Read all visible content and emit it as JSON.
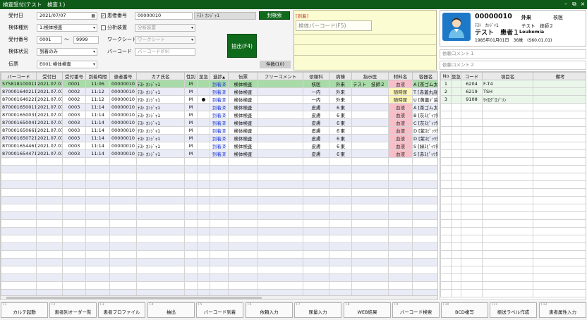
{
  "window": {
    "title": "検査受付(テスト　検査１)"
  },
  "form": {
    "receipt_date_label": "受付日",
    "receipt_date": "2021/07/07",
    "patient_no_label": "患者番号",
    "patient_no": "00000010",
    "patient_kana": "ﾃｽﾄ ｶﾝｼﾞｬ1",
    "seal_search_label": "封検索",
    "specimen_type_label": "検体種別",
    "specimen_type": "1:検体検査",
    "analyzer_label": "分析装置",
    "analyzer_placeholder": "分析装置",
    "receipt_no_label": "受付番号",
    "receipt_no_from": "0001",
    "tilde": "〜",
    "receipt_no_to": "9999",
    "worksheet_label": "ワークシート",
    "worksheet_placeholder": "ワークシート",
    "status_label": "検体状況",
    "status": "到着のみ",
    "barcode_label": "バーコード",
    "barcode_placeholder": "バーコード(F9)",
    "slip_label": "伝票",
    "slip": "E001:検体検査",
    "extract_label": "抽出(F4)",
    "count_label": "件数(10)"
  },
  "notice": {
    "header": "[到着]",
    "barcode_placeholder": "検体バーコード(F5)"
  },
  "patient": {
    "id": "00000010",
    "kana": "ﾃｽﾄ　ｶﾝｼﾞｬ1",
    "name": "テスト　患者１",
    "dept": "外来",
    "ward": "核医",
    "doctor": "テスト　技師２",
    "disease": "Leukemia",
    "birth": "1985年01月01日　36歳　(S60.01.01)"
  },
  "comments": {
    "c1": "依頼コメント１",
    "c2": "依頼コメント２"
  },
  "main_table": {
    "headers": [
      "バーコード",
      "受付日",
      "受付番号",
      "到着時間",
      "患者番号",
      "カナ氏名",
      "性別",
      "至急",
      "進捗",
      "伝票",
      "フリーコメント",
      "依頼科",
      "病棟",
      "指示医",
      "材料名",
      "容器名"
    ],
    "sort_mark": "▲",
    "rows": [
      [
        "575818100011",
        "2021.07.07",
        "0001",
        "11:06",
        "00000010",
        "ﾃｽﾄ ｶﾝｼﾞｬ1",
        "M",
        "",
        "到着済",
        "検体検査",
        "",
        "核医",
        "外来",
        "テスト　技師２",
        "血液",
        "A [茶ゴム太長]"
      ],
      [
        "870001640211",
        "2021.07.07",
        "0002",
        "11:12",
        "00000010",
        "ﾃｽﾄ ｶﾝｼﾞｬ1",
        "M",
        "",
        "到着済",
        "検体検査",
        "",
        "一内",
        "外来",
        "",
        "随時尿",
        "T [赤蓋丸底]"
      ],
      [
        "870001640221",
        "2021.07.07",
        "0002",
        "11:12",
        "00000010",
        "ﾃｽﾄ ｶﾝｼﾞｬ1",
        "M",
        "●",
        "到着済",
        "検体検査",
        "",
        "一内",
        "外来",
        "",
        "随時尿",
        "U [黄蓋ﾏﾞ底]"
      ],
      [
        "870001650011",
        "2021.07.07",
        "0003",
        "11:14",
        "00000010",
        "ﾃｽﾄ ｶﾝｼﾞｬ1",
        "M",
        "",
        "到着済",
        "検体検査",
        "",
        "皮膚",
        "６東",
        "",
        "血液",
        "A [茶ゴム太長]"
      ],
      [
        "870001650031",
        "2021.07.07",
        "0003",
        "11:14",
        "00000010",
        "ﾃｽﾄ ｶﾝｼﾞｬ1",
        "M",
        "",
        "到着済",
        "検体検査",
        "",
        "皮膚",
        "６東",
        "",
        "血液",
        "B [灰ｽﾋﾟｯﾂ短]"
      ],
      [
        "870001650041",
        "2021.07.07",
        "0003",
        "11:14",
        "00000010",
        "ﾃｽﾄ ｶﾝｼﾞｬ1",
        "M",
        "",
        "到着済",
        "検体検査",
        "",
        "皮膚",
        "６東",
        "",
        "血液",
        "C [灰ｽﾋﾟｯﾂ短]"
      ],
      [
        "870001650661",
        "2021.07.07",
        "0003",
        "11:14",
        "00000010",
        "ﾃｽﾄ ｶﾝｼﾞｬ1",
        "M",
        "",
        "到着済",
        "検体検査",
        "",
        "皮膚",
        "６東",
        "",
        "血液",
        "D [紫ｽﾋﾟｯﾂ短]"
      ],
      [
        "870001650721",
        "2021.07.07",
        "0003",
        "11:14",
        "00000010",
        "ﾃｽﾄ ｶﾝｼﾞｬ1",
        "M",
        "",
        "到着済",
        "検体検査",
        "",
        "皮膚",
        "６東",
        "",
        "血液",
        "D [紫ｽﾋﾟｯﾂ短]"
      ],
      [
        "870001654461",
        "2021.07.07",
        "0003",
        "11:14",
        "00000010",
        "ﾃｽﾄ ｶﾝｼﾞｬ1",
        "M",
        "",
        "到着済",
        "検体検査",
        "",
        "皮膚",
        "６東",
        "",
        "血液",
        "S [緑ｽﾋﾟｯﾂ短]"
      ],
      [
        "870001654471",
        "2021.07.07",
        "0003",
        "11:14",
        "00000010",
        "ﾃｽﾄ ｶﾝｼﾞｬ1",
        "M",
        "",
        "到着済",
        "検体検査",
        "",
        "皮膚",
        "６東",
        "",
        "血液",
        "S [赤ｽﾋﾟｯﾂ短]"
      ]
    ]
  },
  "item_table": {
    "headers": [
      "No",
      "至急",
      "コード",
      "項目名",
      "備考"
    ],
    "rows": [
      [
        "1",
        "",
        "6204",
        "F-T4",
        ""
      ],
      [
        "2",
        "",
        "6219",
        "TSH",
        ""
      ],
      [
        "3",
        "",
        "9108",
        "ｻｲﾛｸﾞﾛﾌﾞﾘﾝ",
        ""
      ]
    ]
  },
  "fkeys": [
    {
      "n": "F1",
      "label": "カルテ起動"
    },
    {
      "n": "F2",
      "label": "患者別オーダー覧"
    },
    {
      "n": "F3",
      "label": "患者プロファイル"
    },
    {
      "n": "F4",
      "label": "抽出"
    },
    {
      "n": "F5",
      "label": "バーコード到着"
    },
    {
      "n": "F6",
      "label": "依頼入力"
    },
    {
      "n": "F7",
      "label": "尿量入力"
    },
    {
      "n": "F8",
      "label": "WEB結果"
    },
    {
      "n": "F9",
      "label": "バーコード検索"
    },
    {
      "n": "F10",
      "label": "BCD複写"
    },
    {
      "n": "F11",
      "label": "振送ラベル作成"
    },
    {
      "n": "F12",
      "label": "患者属性入力"
    }
  ],
  "colors": {
    "title_green": "#0f5a18",
    "selected_row": "#a8dba8",
    "alt_row": "#e9ebf6",
    "blood": "#f7bfc8",
    "urine": "#fbf5b8",
    "progress": "#1a35d6"
  }
}
